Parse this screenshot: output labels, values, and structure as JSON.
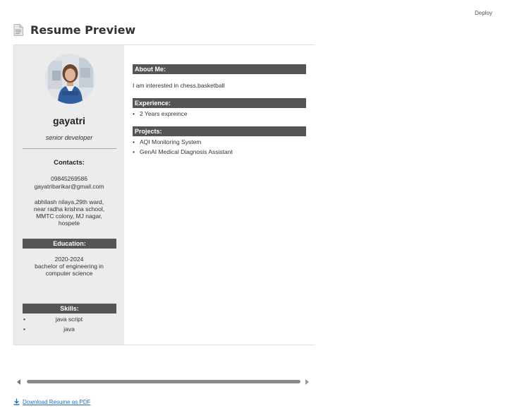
{
  "header": {
    "deploy_label": "Deploy",
    "title": "Resume Preview",
    "title_icon": "document-icon"
  },
  "resume": {
    "name": "gayatri",
    "role": "senior developer",
    "contacts_title": "Contacts:",
    "phone": "09845269586",
    "email": "gayatribarikar@gmail.com",
    "address_lines": [
      "abhilash nilaya,29th ward,",
      "near radha krishna school,",
      "MMTC colony, MJ nagar,",
      "hospete"
    ],
    "education_title": "Education:",
    "education_years": "2020-2024",
    "education_degree_lines": [
      "bachelor of engineering in",
      "computer science"
    ],
    "skills_title": "Skills:",
    "skills": [
      "java script",
      "java"
    ],
    "about_title": "About Me:",
    "about_text": "I am interested in chess,basketball",
    "experience_title": "Experience:",
    "experience": [
      "2 Years expreince"
    ],
    "projects_title": "Projects:",
    "projects": [
      "AQI Monitoring System",
      "GenAI Medical Diagnosis Assistant"
    ]
  },
  "download": {
    "label": "Download Resume as PDF",
    "icon": "download-icon"
  },
  "colors": {
    "sidebar_bg": "#ececec",
    "section_bar": "#555555",
    "link": "#1f6fb5"
  }
}
